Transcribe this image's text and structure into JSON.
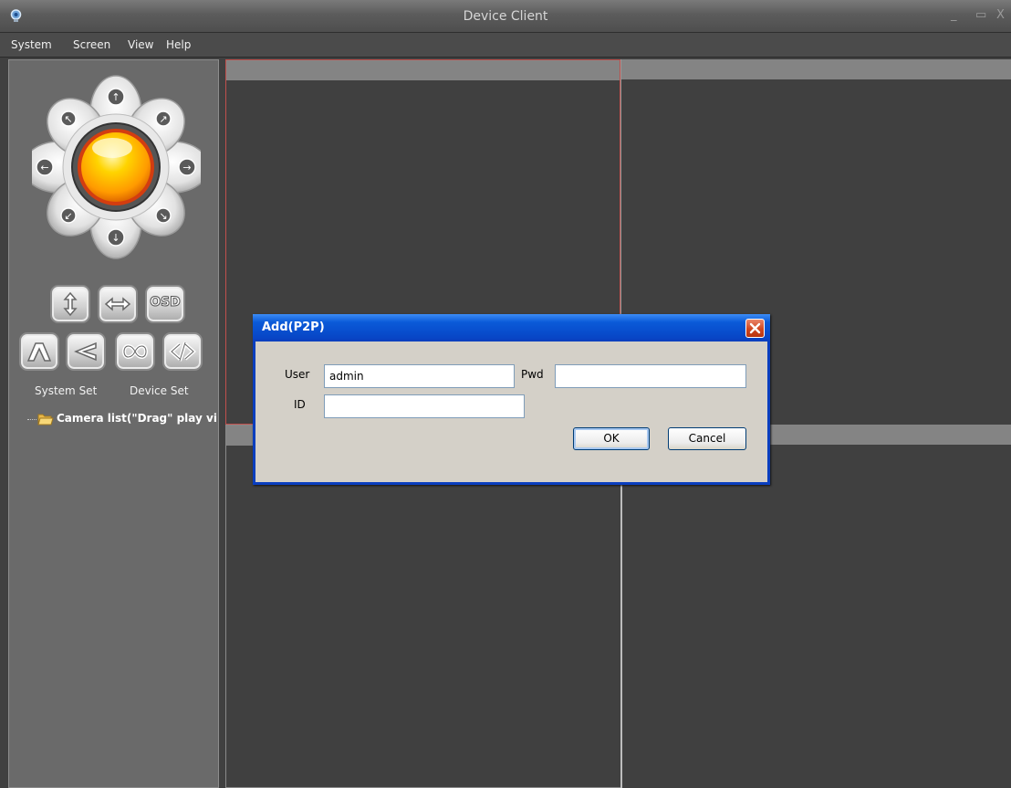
{
  "window": {
    "title": "Device Client",
    "controls": {
      "minimize": "_",
      "maximize": "▭",
      "close": "X"
    }
  },
  "menu": [
    {
      "label": "System"
    },
    {
      "label": "Screen"
    },
    {
      "label": "View"
    },
    {
      "label": "Help"
    }
  ],
  "left_panel": {
    "ptz_controls": [
      "ptz-up",
      "ptz-down",
      "ptz-left",
      "ptz-right",
      "ptz-up-left",
      "ptz-up-right",
      "ptz-down-left",
      "ptz-down-right",
      "ptz-center"
    ],
    "function_buttons_row1": [
      "vertical-flip-icon",
      "horizontal-flip-icon"
    ],
    "osd_label": "OSD",
    "function_buttons_row2": [
      "tilt-icon",
      "pan-icon",
      "cruise-icon",
      "code-icon"
    ],
    "system_set_label": "System Set",
    "device_set_label": "Device Set",
    "tree": {
      "root_label": "Camera list(\"Drag\" play vi"
    }
  },
  "video_grid": {
    "panes": 4,
    "selected_pane": 1,
    "colors": {
      "background": "#404040",
      "pane_header": "#848484",
      "selected_border": "#c0504d"
    }
  },
  "dialog": {
    "title": "Add(P2P)",
    "fields": {
      "user_label": "User",
      "user_value": "admin",
      "pwd_label": "Pwd",
      "pwd_value": "",
      "id_label": "ID",
      "id_value": ""
    },
    "ok_label": "OK",
    "cancel_label": "Cancel",
    "colors": {
      "titlebar": "#0a5ad8",
      "body": "#d4d0c8",
      "close_button": "#d0461f"
    }
  }
}
